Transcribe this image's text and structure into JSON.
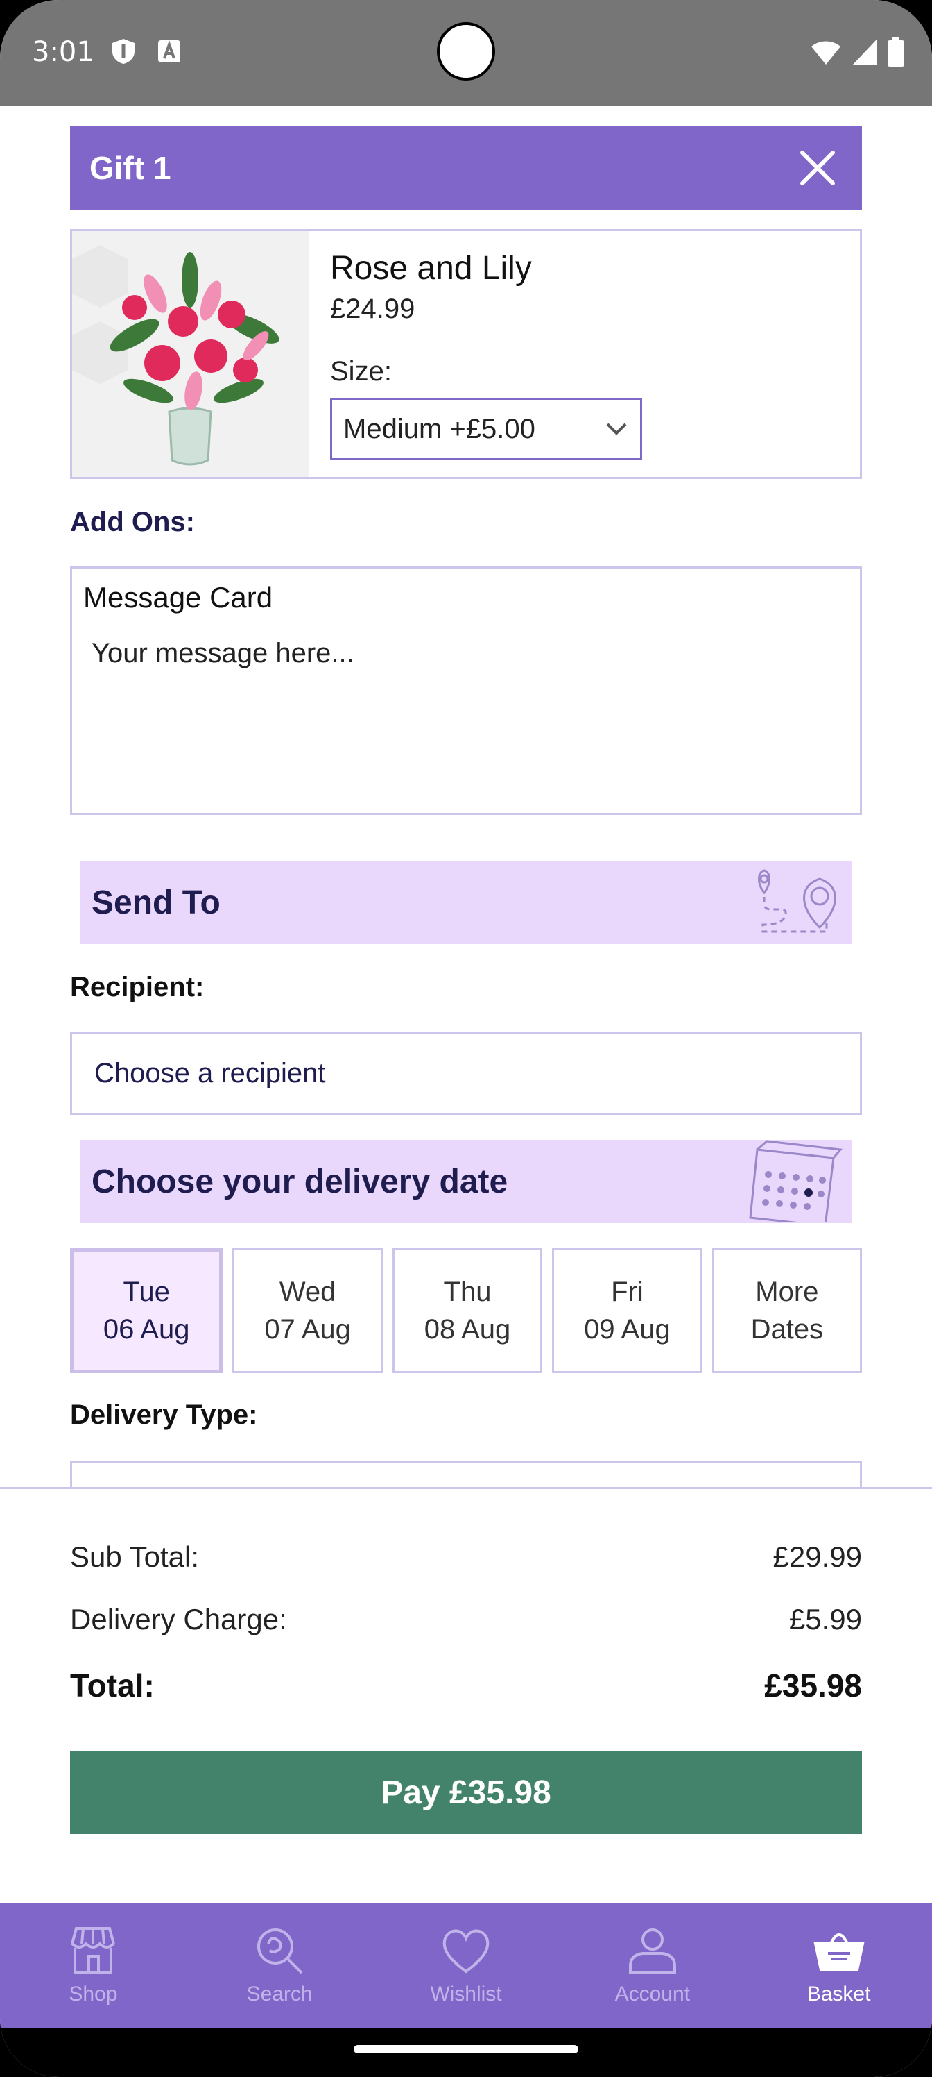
{
  "status_bar": {
    "time": "3:01"
  },
  "gift": {
    "title": "Gift 1",
    "product_name": "Rose and Lily",
    "price": "£24.99",
    "size_label": "Size:",
    "size_value": "Medium +£5.00"
  },
  "addons": {
    "label": "Add Ons:",
    "message_card_title": "Message Card",
    "message_placeholder": "Your message here..."
  },
  "send_to": {
    "title": "Send To",
    "recipient_label": "Recipient:",
    "recipient_placeholder": "Choose a recipient"
  },
  "delivery": {
    "title": "Choose your delivery date",
    "dates": [
      {
        "day": "Tue",
        "date": "06 Aug",
        "selected": true
      },
      {
        "day": "Wed",
        "date": "07 Aug",
        "selected": false
      },
      {
        "day": "Thu",
        "date": "08 Aug",
        "selected": false
      },
      {
        "day": "Fri",
        "date": "09 Aug",
        "selected": false
      },
      {
        "day": "More",
        "date": "Dates",
        "selected": false
      }
    ],
    "type_label": "Delivery Type:"
  },
  "totals": {
    "subtotal_label": "Sub Total:",
    "subtotal_value": "£29.99",
    "delivery_label": "Delivery Charge:",
    "delivery_value": "£5.99",
    "total_label": "Total:",
    "total_value": "£35.98"
  },
  "pay_button": "Pay £35.98",
  "nav": [
    {
      "label": "Shop",
      "icon": "shop-icon",
      "active": false
    },
    {
      "label": "Search",
      "icon": "search-icon",
      "active": false
    },
    {
      "label": "Wishlist",
      "icon": "heart-icon",
      "active": false
    },
    {
      "label": "Account",
      "icon": "account-icon",
      "active": false
    },
    {
      "label": "Basket",
      "icon": "basket-icon",
      "active": true
    }
  ],
  "colors": {
    "brand_purple": "#8066c8",
    "banner_lilac": "#e9d8fb",
    "pay_green": "#43836b",
    "navy_text": "#1f1c4f"
  }
}
